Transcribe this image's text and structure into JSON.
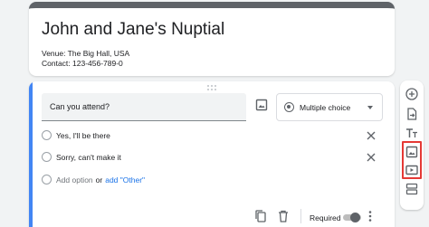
{
  "form": {
    "title": "John and Jane's Nuptial",
    "venue": "Venue: The Big Hall, USA",
    "contact": "Contact: 123-456-789-0"
  },
  "question": {
    "text": "Can you attend?",
    "type": "Multiple choice",
    "options": [
      {
        "label": "Yes,  I'll be there"
      },
      {
        "label": "Sorry, can't make it"
      }
    ],
    "add_option": "Add option",
    "or": "or",
    "add_other": "add \"Other\"",
    "required_label": "Required",
    "required": true
  },
  "colors": {
    "accent": "#4285f4",
    "highlight": "#e53935"
  },
  "toolbar": {
    "icons": [
      "add-question-icon",
      "import-questions-icon",
      "add-title-icon",
      "add-image-icon",
      "add-video-icon",
      "add-section-icon"
    ]
  }
}
